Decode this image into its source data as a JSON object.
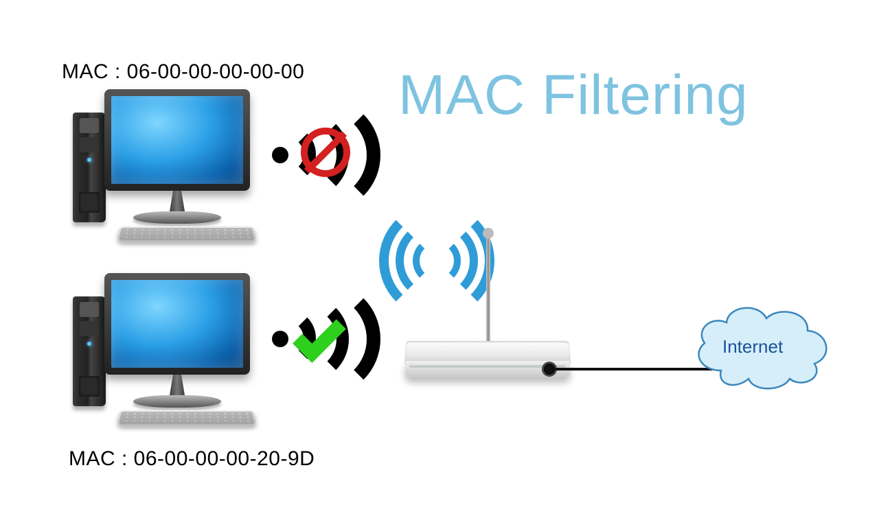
{
  "title": "MAC Filtering",
  "devices": {
    "blocked": {
      "mac_label": "MAC : 06-00-00-00-00-00",
      "status": "blocked"
    },
    "allowed": {
      "mac_label": "MAC : 06-00-00-00-20-9D",
      "status": "allowed"
    }
  },
  "internet_label": "Internet",
  "colors": {
    "title": "#7ec3e0",
    "blocked": "#d32020",
    "allowed": "#2fcf1e",
    "wifi_signal": "#2f9cd8",
    "cloud_fill": "#bde4f5",
    "cloud_stroke": "#3a87bc"
  }
}
